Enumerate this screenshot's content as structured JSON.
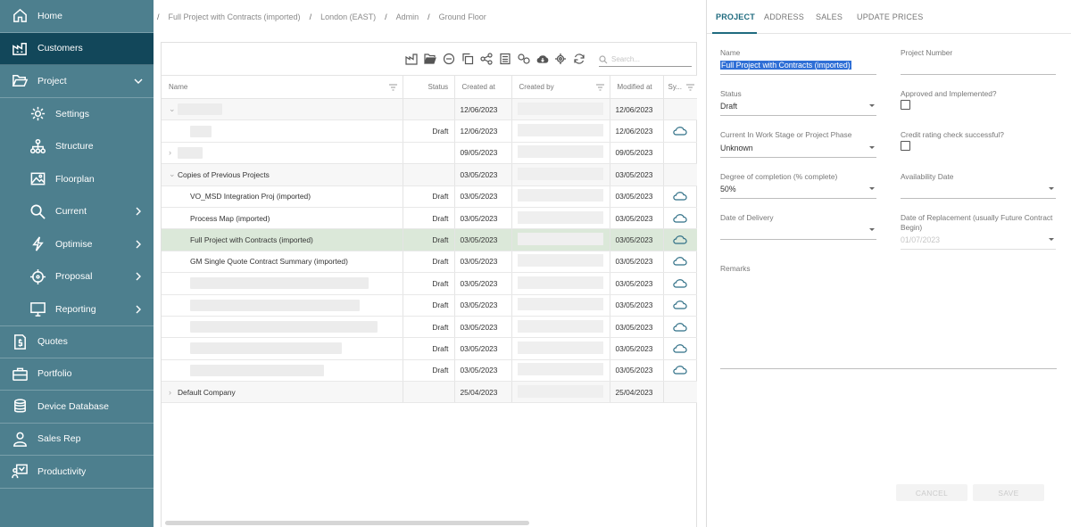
{
  "sidebar": {
    "items": [
      {
        "label": "Home",
        "icon": "home-icon"
      },
      {
        "label": "Customers",
        "icon": "factory-icon",
        "active": true
      },
      {
        "label": "Project",
        "icon": "folder-open-icon",
        "expanded": true
      },
      {
        "label": "Settings",
        "icon": "gear-icon"
      },
      {
        "label": "Structure",
        "icon": "hierarchy-icon"
      },
      {
        "label": "Floorplan",
        "icon": "image-icon"
      },
      {
        "label": "Current",
        "icon": "search-icon"
      },
      {
        "label": "Optimise",
        "icon": "lightning-icon"
      },
      {
        "label": "Proposal",
        "icon": "crosshair-icon"
      },
      {
        "label": "Reporting",
        "icon": "monitor-icon"
      },
      {
        "label": "Quotes",
        "icon": "dollar-document-icon"
      },
      {
        "label": "Portfolio",
        "icon": "briefcase-icon"
      },
      {
        "label": "Device Database",
        "icon": "database-icon"
      },
      {
        "label": "Sales Rep",
        "icon": "user-icon"
      },
      {
        "label": "Productivity",
        "icon": "presentation-icon"
      }
    ]
  },
  "breadcrumb": [
    "Full Project with Contracts (imported)",
    "London (EAST)",
    "Admin",
    "Ground Floor"
  ],
  "grid": {
    "search_placeholder": "Search...",
    "columns": [
      "Name",
      "Status",
      "Created at",
      "Created by",
      "Modified at",
      "Sy..."
    ],
    "rows": [
      {
        "name": "",
        "status": "",
        "created": "12/06/2023",
        "modified": "12/06/2023",
        "cloud": false
      },
      {
        "name": "",
        "status": "Draft",
        "created": "12/06/2023",
        "modified": "12/06/2023",
        "cloud": true
      },
      {
        "name": "",
        "status": "",
        "created": "09/05/2023",
        "modified": "09/05/2023",
        "cloud": false
      },
      {
        "name": "Copies of Previous Projects",
        "status": "",
        "created": "03/05/2023",
        "modified": "03/05/2023",
        "cloud": false
      },
      {
        "name": "VO_MSD Integration Proj (imported)",
        "status": "Draft",
        "created": "03/05/2023",
        "modified": "03/05/2023",
        "cloud": true
      },
      {
        "name": "Process Map (imported)",
        "status": "Draft",
        "created": "03/05/2023",
        "modified": "03/05/2023",
        "cloud": true
      },
      {
        "name": "Full Project with Contracts (imported)",
        "status": "Draft",
        "created": "03/05/2023",
        "modified": "03/05/2023",
        "cloud": true
      },
      {
        "name": "GM Single Quote Contract Summary (imported)",
        "status": "Draft",
        "created": "03/05/2023",
        "modified": "03/05/2023",
        "cloud": true
      },
      {
        "name": "",
        "status": "Draft",
        "created": "03/05/2023",
        "modified": "03/05/2023",
        "cloud": true
      },
      {
        "name": "",
        "status": "Draft",
        "created": "03/05/2023",
        "modified": "03/05/2023",
        "cloud": true
      },
      {
        "name": "",
        "status": "Draft",
        "created": "03/05/2023",
        "modified": "03/05/2023",
        "cloud": true
      },
      {
        "name": "",
        "status": "Draft",
        "created": "03/05/2023",
        "modified": "03/05/2023",
        "cloud": true
      },
      {
        "name": "",
        "status": "Draft",
        "created": "03/05/2023",
        "modified": "03/05/2023",
        "cloud": true
      },
      {
        "name": "Default Company",
        "status": "",
        "created": "25/04/2023",
        "modified": "25/04/2023",
        "cloud": false
      }
    ]
  },
  "panel": {
    "tabs": [
      "PROJECT",
      "ADDRESS",
      "SALES",
      "UPDATE PRICES"
    ],
    "fields": {
      "name_label": "Name",
      "name_value": "Full Project with Contracts (imported)",
      "project_number_label": "Project Number",
      "status_label": "Status",
      "status_value": "Draft",
      "approved_label": "Approved and Implemented?",
      "stage_label": "Current In Work Stage or Project Phase",
      "stage_value": "Unknown",
      "credit_label": "Credit rating check successful?",
      "degree_label": "Degree of completion (% complete)",
      "degree_value": "50%",
      "availability_label": "Availability Date",
      "delivery_label": "Date of Delivery",
      "replacement_label": "Date of Replacement (usually Future Contract Begin)",
      "replacement_value": "01/07/2023",
      "remarks_label": "Remarks"
    },
    "cancel_label": "CANCEL",
    "save_label": "SAVE"
  },
  "colors": {
    "sidebar": "#4d7f8e",
    "sidebar_active": "#12475a",
    "accent": "#1f6b7f",
    "selected_row": "#dbe8d9"
  }
}
